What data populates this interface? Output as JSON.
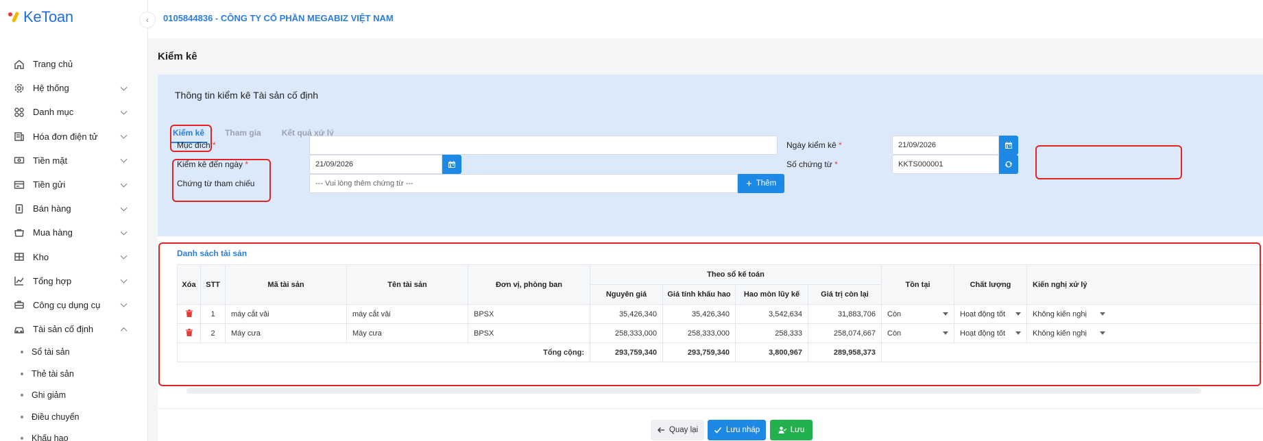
{
  "app": {
    "logo_text": "KeToan"
  },
  "header": {
    "company": "0105844836 - CÔNG TY CỔ PHẦN MEGABIZ VIỆT NAM"
  },
  "sidebar": {
    "items": [
      {
        "label": "Trang chủ",
        "icon": "home-icon"
      },
      {
        "label": "Hệ thống",
        "icon": "gear-icon"
      },
      {
        "label": "Danh mục",
        "icon": "grid-icon"
      },
      {
        "label": "Hóa đơn điện tử",
        "icon": "invoice-icon"
      },
      {
        "label": "Tiền mặt",
        "icon": "cash-icon"
      },
      {
        "label": "Tiền gửi",
        "icon": "bank-icon"
      },
      {
        "label": "Bán hàng",
        "icon": "sell-icon"
      },
      {
        "label": "Mua hàng",
        "icon": "cart-icon"
      },
      {
        "label": "Kho",
        "icon": "warehouse-icon"
      },
      {
        "label": "Tổng hợp",
        "icon": "chart-icon"
      },
      {
        "label": "Công cụ dụng cụ",
        "icon": "tools-icon"
      },
      {
        "label": "Tài sản cố định",
        "icon": "car-icon"
      }
    ],
    "subitems": [
      "Sổ tài sản",
      "Thẻ tài sản",
      "Ghi giảm",
      "Điều chuyển",
      "Khấu hao"
    ]
  },
  "page": {
    "title": "Kiểm kê"
  },
  "info": {
    "title": "Thông tin kiểm kê Tài sản cố định",
    "tabs": [
      "Kiểm kê",
      "Tham gia",
      "Kết quả xử lý"
    ],
    "purpose_label": "Mục đích",
    "purpose_value": "",
    "until_label": "Kiểm kê đến ngày",
    "until_value": "21/09/2026",
    "ref_label": "Chứng từ tham chiếu",
    "ref_placeholder": "--- Vui lòng thêm chứng từ ---",
    "add_label": "Thêm",
    "date_label": "Ngày kiểm kê",
    "date_value": "21/09/2026",
    "doc_no_label": "Số chứng từ",
    "doc_no_value": "KKTS000001",
    "required_mark": "*"
  },
  "list": {
    "title": "Danh sách tài sản",
    "headers": {
      "delete": "Xóa",
      "stt": "STT",
      "code": "Mã tài sản",
      "name": "Tên tài sản",
      "dept": "Đơn vị, phòng ban",
      "group": "Theo sổ kế toán",
      "original": "Nguyên giá",
      "depr_value": "Giá tính khấu hao",
      "accum": "Hao mòn lũy kế",
      "remaining": "Giá trị còn lại",
      "exists": "Tồn tại",
      "quality": "Chất lượng",
      "proposal": "Kiến nghị xử lý"
    },
    "rows": [
      {
        "stt": "1",
        "code": "máy cắt vải",
        "name": "máy cắt vải",
        "dept": "BPSX",
        "original": "35,426,340",
        "depr_value": "35,426,340",
        "accum": "3,542,634",
        "remaining": "31,883,706",
        "exists": "Còn",
        "quality": "Hoạt động tốt",
        "proposal": "Không kiến nghị"
      },
      {
        "stt": "2",
        "code": "Máy cưa",
        "name": "Máy cưa",
        "dept": "BPSX",
        "original": "258,333,000",
        "depr_value": "258,333,000",
        "accum": "258,333",
        "remaining": "258,074,667",
        "exists": "Còn",
        "quality": "Hoạt động tốt",
        "proposal": "Không kiến nghị"
      }
    ],
    "total_label": "Tổng cộng:",
    "totals": {
      "original": "293,759,340",
      "depr_value": "293,759,340",
      "accum": "3,800,967",
      "remaining": "289,958,373"
    }
  },
  "actions": {
    "back": "Quay lại",
    "draft": "Lưu nháp",
    "save": "Lưu"
  },
  "colors": {
    "primary": "#1e88e5",
    "success": "#22b14c",
    "danger": "#e53935",
    "panel": "#dbe9fb"
  }
}
